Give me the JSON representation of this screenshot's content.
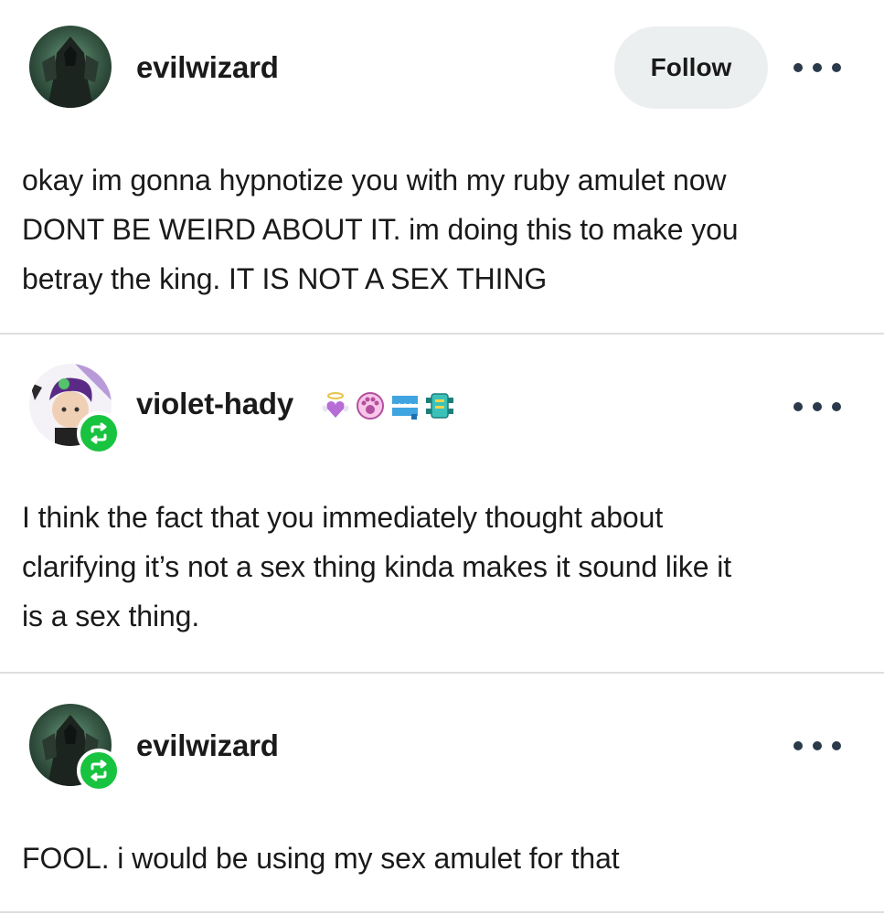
{
  "posts": [
    {
      "username": "evilwizard",
      "follow_label": "Follow",
      "body_lines": [
        "okay im gonna hypnotize you with my ruby amulet now",
        "DONT BE WEIRD ABOUT IT. im doing this to make you",
        "betray the king. IT IS NOT A SEX THING"
      ]
    },
    {
      "username": "violet-hady",
      "badges": [
        "angel-heart-badge",
        "paw-badge",
        "blue-trap-badge",
        "teal-crab-badge"
      ],
      "body_lines": [
        "I think the fact that you immediately thought about",
        "clarifying it’s not a sex thing kinda makes it sound like it",
        "is a sex thing."
      ]
    },
    {
      "username": "evilwizard",
      "body_lines": [
        "FOOL. i would be using my sex amulet for that"
      ]
    }
  ],
  "colors": {
    "reblog_green": "#18c33f",
    "follow_bg": "#eceff0",
    "divider": "#dedede"
  }
}
